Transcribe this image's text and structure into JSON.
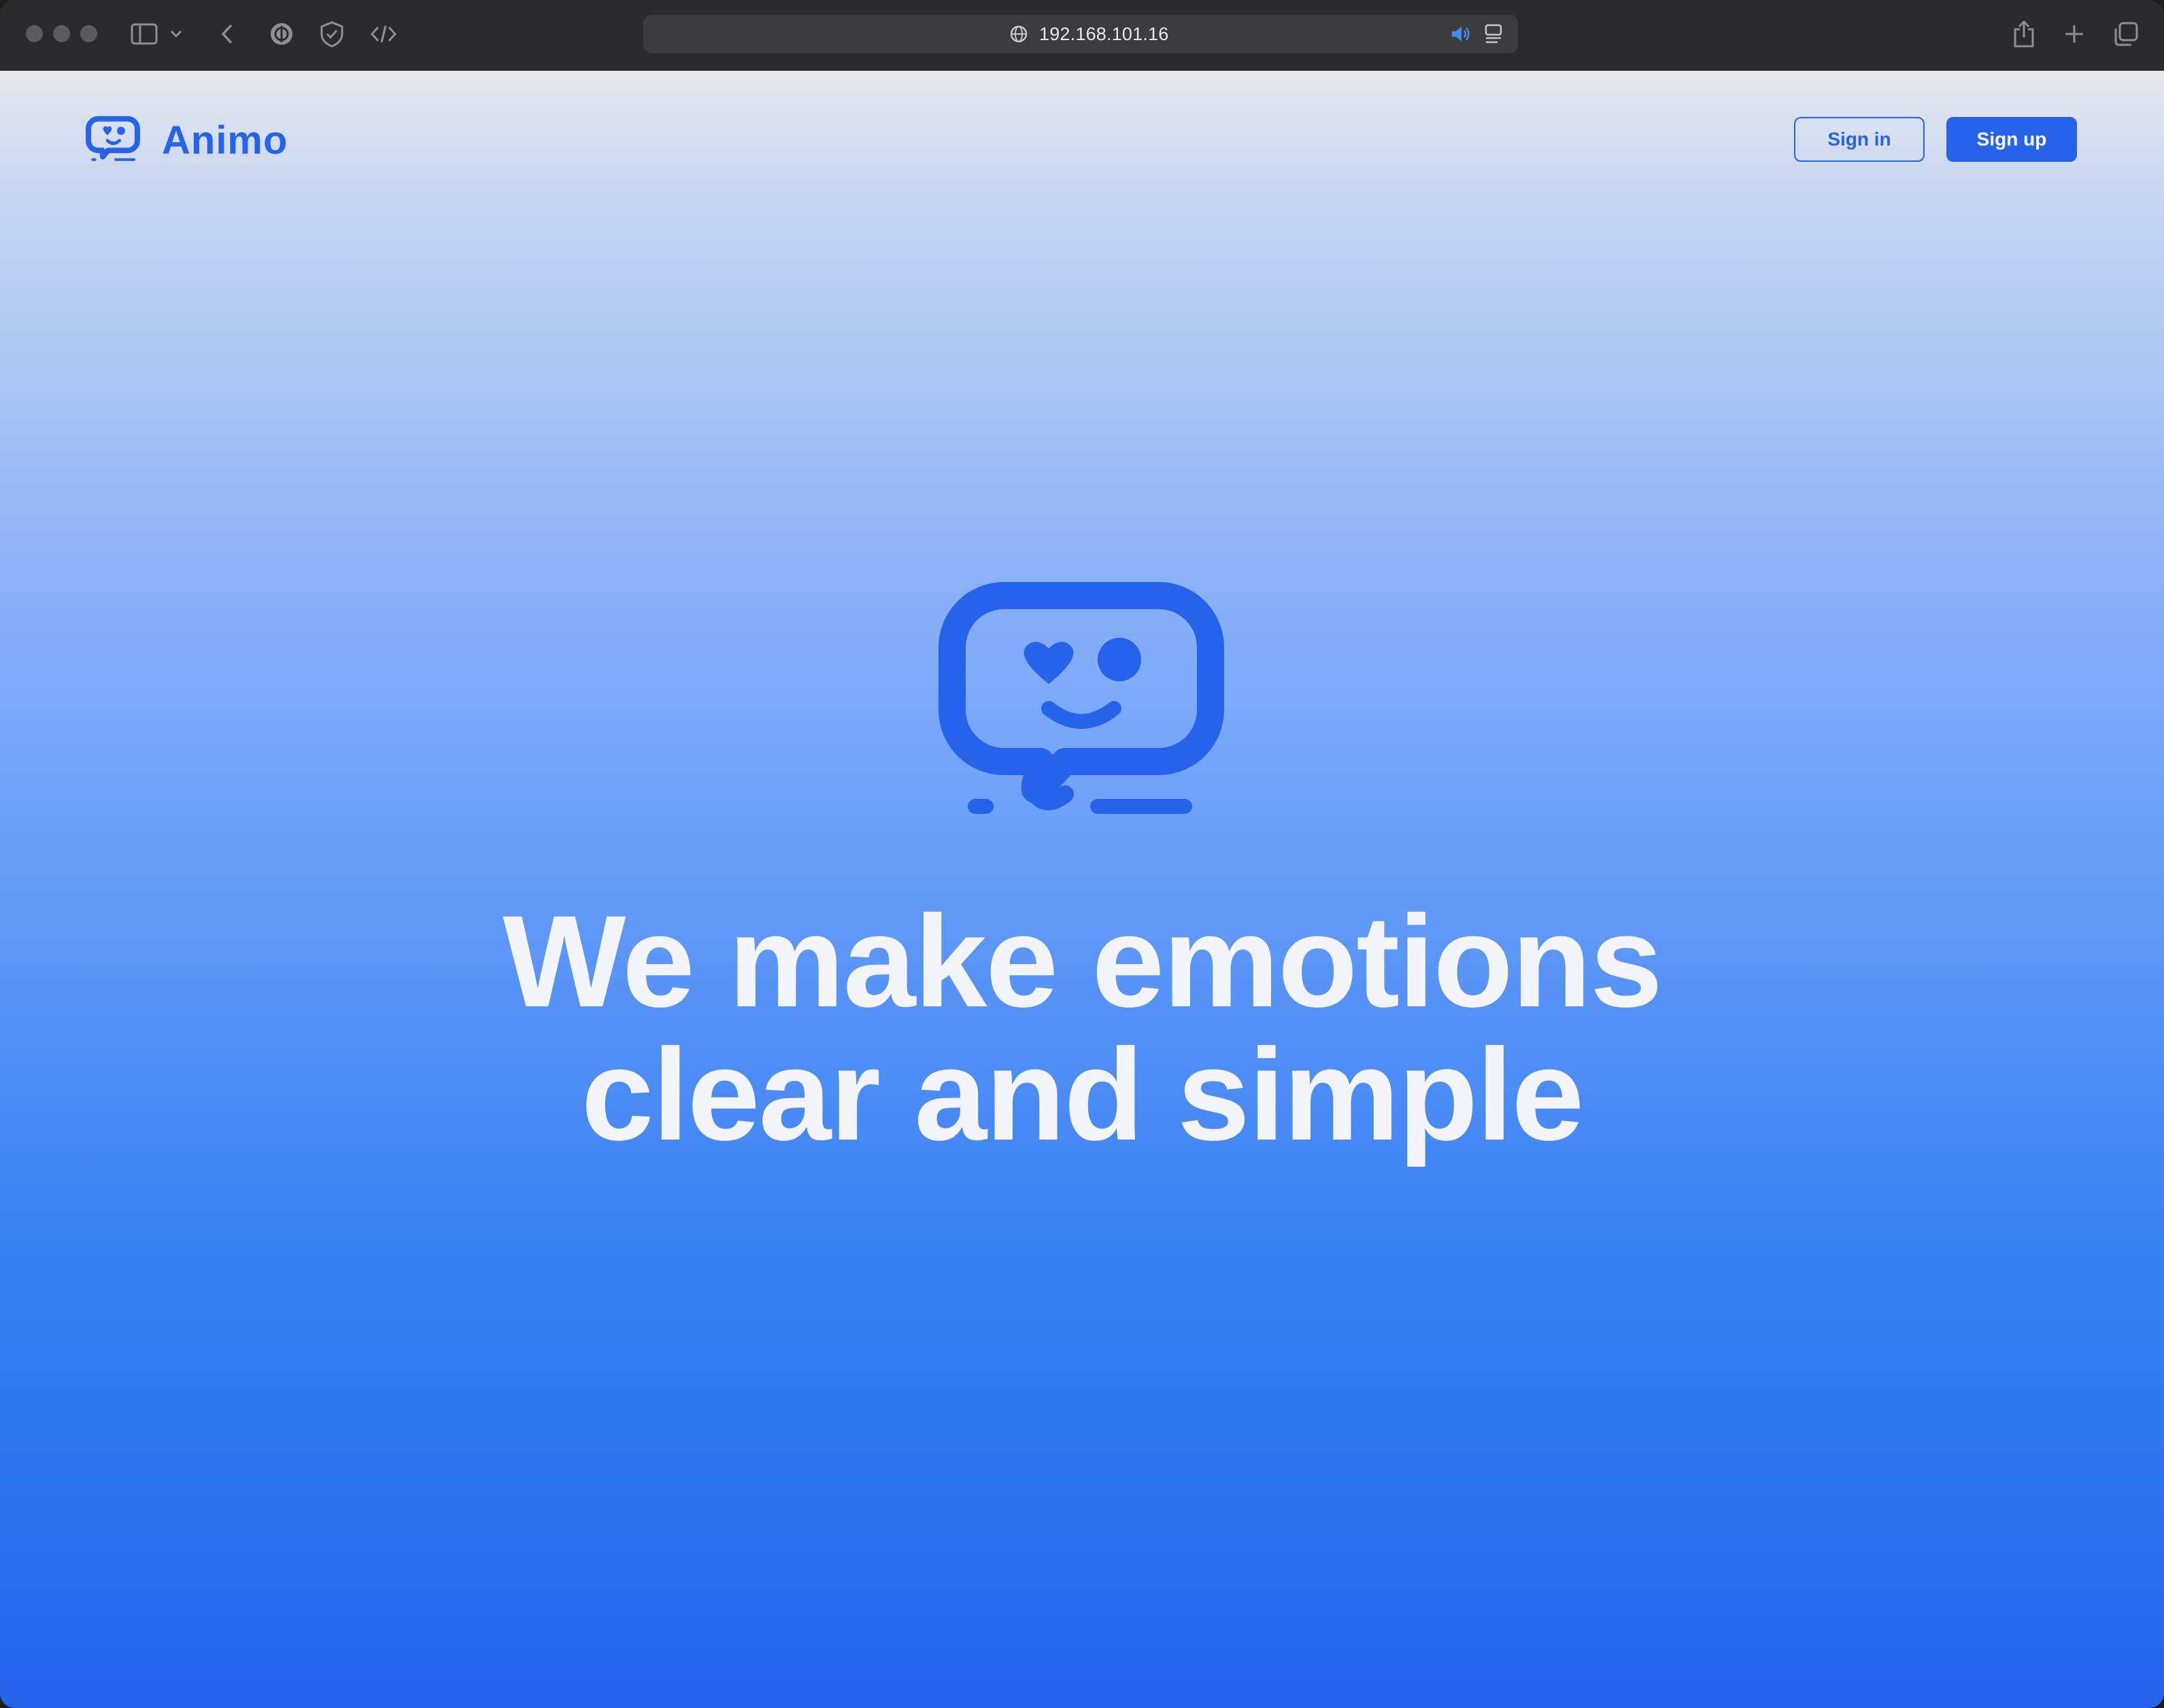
{
  "browser": {
    "address": "192.168.101.16",
    "icons": [
      "sidebar-icon",
      "chevron-down-icon",
      "back-icon",
      "privacy-icon",
      "shield-icon",
      "code-icon",
      "globe-icon",
      "audio-icon",
      "reader-icon",
      "share-icon",
      "new-tab-icon",
      "tabs-overview-icon"
    ]
  },
  "header": {
    "brand_name": "Animo",
    "sign_in_label": "Sign in",
    "sign_up_label": "Sign up"
  },
  "hero": {
    "line1": "We make emotions",
    "line2": "clear and simple"
  },
  "colors": {
    "brand": "#2563eb",
    "hero_text": "#f3f5fa",
    "toolbar": "#2b2b2d"
  }
}
